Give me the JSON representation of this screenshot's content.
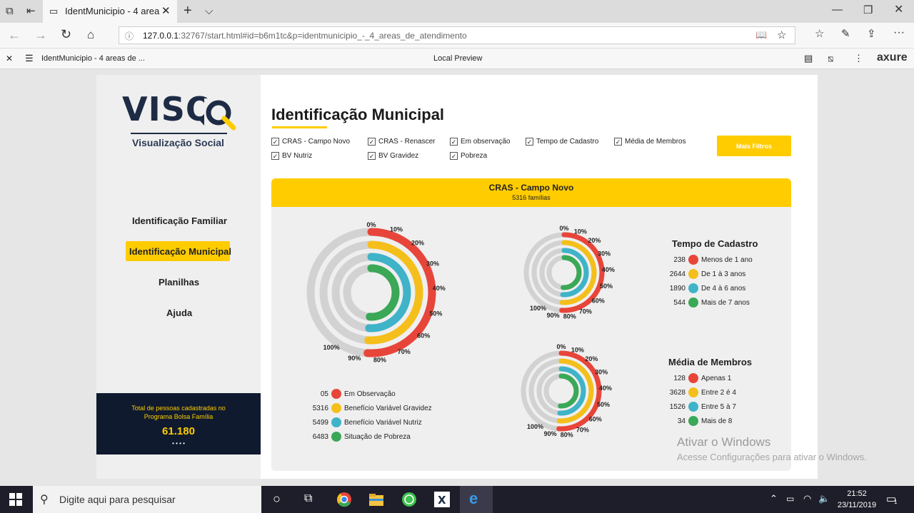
{
  "browser": {
    "tab_title": "IdentMunicipio - 4 area",
    "url_host": "127.0.0.1",
    "url_rest": ":32767/start.html#id=b6m1tc&p=identmunicipio_-_4_areas_de_atendimento",
    "axure_page": "IdentMunicipio - 4 areas de ...",
    "preview_label": "Local Preview",
    "axure_logo": "axure"
  },
  "sidebar": {
    "logo_text": "VISQ",
    "logo_sub": "Visualização Social",
    "nav": [
      "Identificação Familiar",
      "Identificação Municipal",
      "Planilhas",
      "Ajuda"
    ],
    "total_label": "Total de pessoas cadastradas no Programa Bolsa Família",
    "total_value": "61.180",
    "dots": "• • • •"
  },
  "main": {
    "title": "Identificação Municipal",
    "filters": [
      "CRAS - Campo Novo",
      "CRAS - Renascer",
      "Em observação",
      "Tempo de Cadastro",
      "Média de Membros",
      "BV Nutriz",
      "BV Gravidez",
      "Pobreza"
    ],
    "more_filters": "Mais Filtros",
    "panel_title": "CRAS - Campo Novo",
    "panel_sub": "5316 famílias"
  },
  "colors": {
    "red": "#e8453a",
    "yellow": "#f5bf1b",
    "teal": "#3fb3c8",
    "green": "#3aa857",
    "accent": "#ffcc00",
    "navy": "#1e2b45"
  },
  "chart_ticks": [
    "0%",
    "10%",
    "20%",
    "30%",
    "40%",
    "50%",
    "60%",
    "70%",
    "80%",
    "90%",
    "100%"
  ],
  "legend_main": [
    {
      "count": "05",
      "label": "Em Observação",
      "color": "#e8453a"
    },
    {
      "count": "5316",
      "label": "Benefício Variável Gravidez",
      "color": "#f5bf1b"
    },
    {
      "count": "5499",
      "label": "Benefício Variável Nutriz",
      "color": "#3fb3c8"
    },
    {
      "count": "6483",
      "label": "Situação de Pobreza",
      "color": "#3aa857"
    }
  ],
  "tempo": {
    "title": "Tempo de Cadastro",
    "items": [
      {
        "count": "238",
        "label": "Menos de 1 ano",
        "color": "#e8453a"
      },
      {
        "count": "2644",
        "label": "De 1 à 3 anos",
        "color": "#f5bf1b"
      },
      {
        "count": "1890",
        "label": "De 4 à 6 anos",
        "color": "#3fb3c8"
      },
      {
        "count": "544",
        "label": "Mais de 7 anos",
        "color": "#3aa857"
      }
    ]
  },
  "media": {
    "title": "Média de Membros",
    "items": [
      {
        "count": "128",
        "label": "Apenas 1",
        "color": "#e8453a"
      },
      {
        "count": "3628",
        "label": "Entre 2 é 4",
        "color": "#f5bf1b"
      },
      {
        "count": "1526",
        "label": "Entre 5 à 7",
        "color": "#3fb3c8"
      },
      {
        "count": "34",
        "label": "Mais de 8",
        "color": "#3aa857"
      }
    ]
  },
  "watermark": {
    "line1": "Ativar o Windows",
    "line2": "Acesse Configurações para ativar o Windows."
  },
  "taskbar": {
    "search_placeholder": "Digite aqui para pesquisar",
    "time": "21:52",
    "date": "23/11/2019",
    "notif_count": "1"
  }
}
